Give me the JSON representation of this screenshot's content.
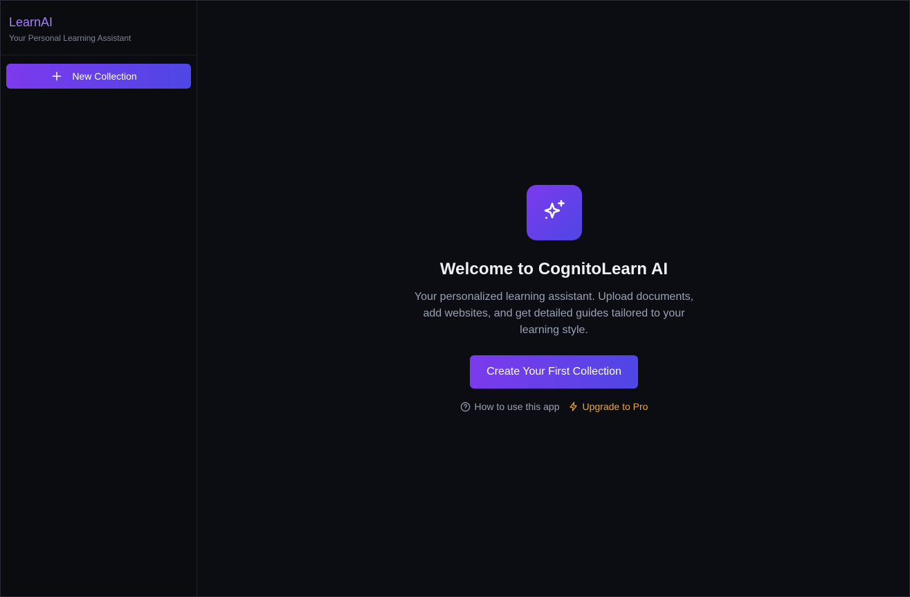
{
  "sidebar": {
    "brand_title": "LearnAI",
    "brand_subtitle": "Your Personal Learning Assistant",
    "new_collection_label": "New Collection"
  },
  "main": {
    "logo_icon": "sparkles-icon",
    "welcome_title": "Welcome to CognitoLearn AI",
    "welcome_description": "Your personalized learning assistant. Upload documents, add websites, and get detailed guides tailored to your learning style.",
    "create_button_label": "Create Your First Collection",
    "help_link_label": "How to use this app",
    "upgrade_link_label": "Upgrade to Pro"
  },
  "colors": {
    "accent_start": "#7c3aed",
    "accent_end": "#4f46e5",
    "brand_text": "#a480f7",
    "upgrade": "#f5a524",
    "background": "#0c0d12"
  }
}
